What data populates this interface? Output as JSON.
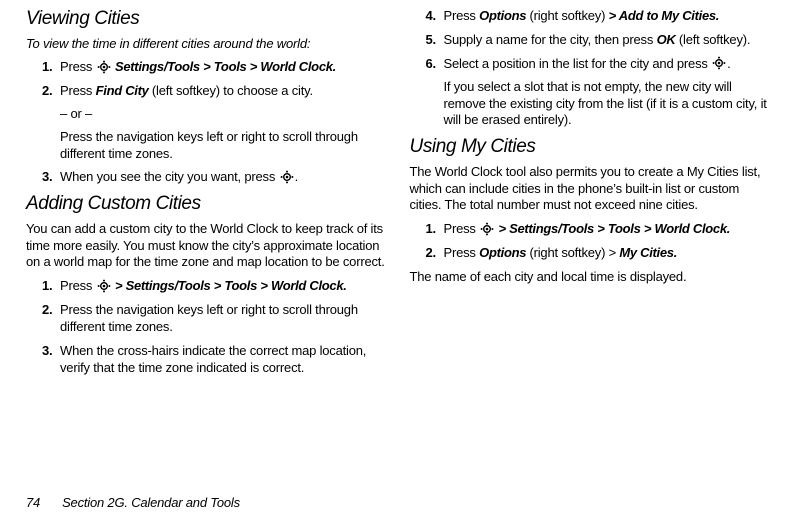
{
  "left": {
    "heading1": "Viewing Cities",
    "intro": "To view the time in different cities around the world:",
    "s1a": "Press ",
    "s1b": " Settings/Tools ",
    "s1c": "> Tools > World Clock.",
    "s2a": "Press ",
    "s2b": "Find City ",
    "s2c": "(left softkey) to choose a city.",
    "s2d": "– or –",
    "s2e": "Press the navigation keys left or right to scroll through different time zones.",
    "s3a": "When you see the city you want, press ",
    "s3b": ".",
    "heading2": "Adding Custom Cities",
    "para1": "You can add a custom city to the World Clock to keep track of its time more easily. You must know the city’s approximate location on a world map for the time zone and map location to be correct.",
    "a1a": "Press ",
    "a1b": " > Settings/Tools > Tools > World Clock.",
    "a2": "Press the navigation keys left or right to scroll through different time zones.",
    "a3": "When the cross-hairs indicate the correct map location, verify that the time zone indicated is correct."
  },
  "right": {
    "b4a": "Press ",
    "b4b": "Options ",
    "b4c": "(right softkey) ",
    "b4d": "> Add to My Cities.",
    "b5a": "Supply a name for the city, then press ",
    "b5b": "OK",
    "b5c": " (left softkey).",
    "b6a": "Select a position in the list for the city and press ",
    "b6b": ".",
    "b6c": "If you select a slot that is not empty, the new city will remove the existing city from the list (if it is a custom city, it will be erased entirely).",
    "heading3": "Using My Cities",
    "para2": "The World Clock tool also permits you to create a My Cities list, which can include cities in the phone’s built-in list or custom cities. The total number must not exceed nine cities.",
    "c1a": "Press ",
    "c1b": " > Settings/Tools > Tools > World Clock.",
    "c2a": "Press ",
    "c2b": "Options ",
    "c2c": "(right softkey) >",
    "c2d": " My Cities.",
    "closing": "The name of each city and local time is displayed."
  },
  "footer": {
    "page": "74",
    "section": "Section 2G. Calendar and Tools"
  }
}
